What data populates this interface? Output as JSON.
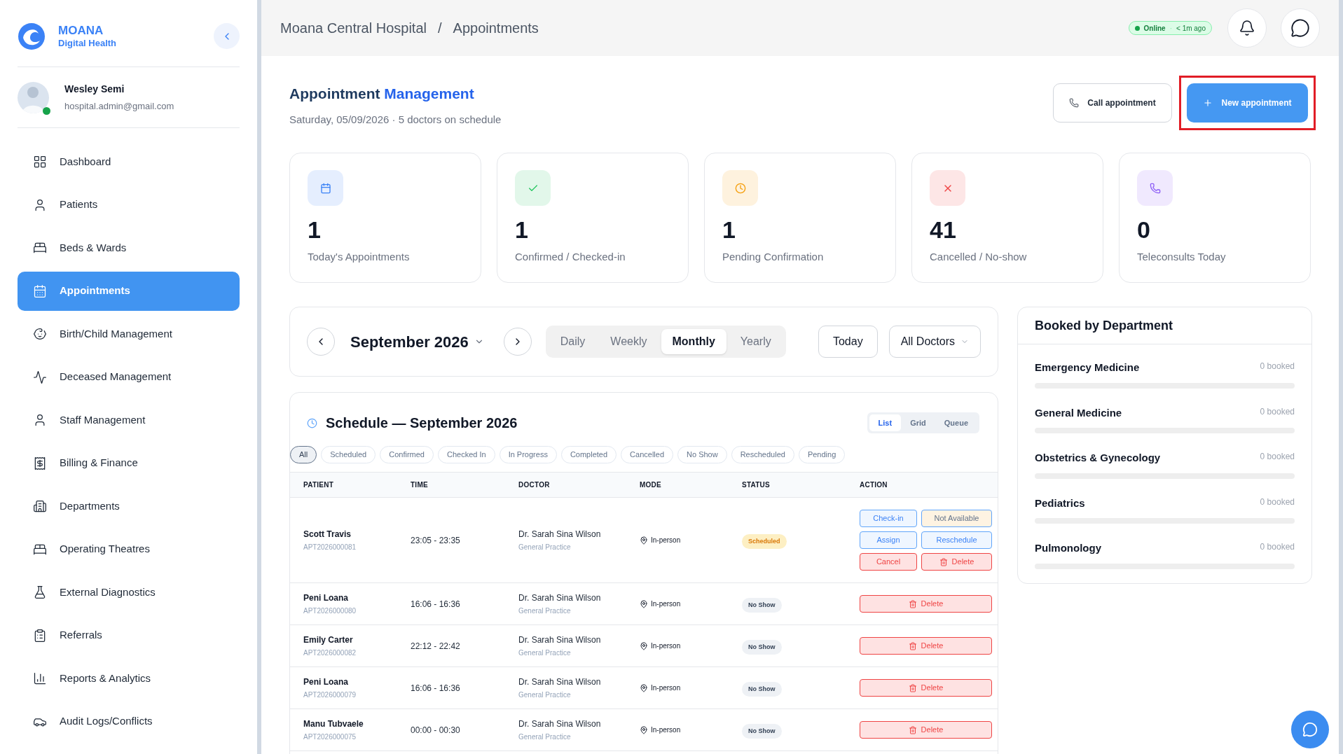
{
  "brand": {
    "name": "MOANA",
    "subtitle": "Digital Health"
  },
  "user": {
    "name": "Wesley Semi",
    "email": "hospital.admin@gmail.com",
    "online": true
  },
  "sidebar": {
    "items": [
      {
        "label": "Dashboard",
        "selected": false
      },
      {
        "label": "Patients",
        "selected": false
      },
      {
        "label": "Beds & Wards",
        "selected": false
      },
      {
        "label": "Appointments",
        "selected": true
      },
      {
        "label": "Birth/Child Management",
        "selected": false
      },
      {
        "label": "Deceased Management",
        "selected": false
      },
      {
        "label": "Staff Management",
        "selected": false
      },
      {
        "label": "Billing & Finance",
        "selected": false
      },
      {
        "label": "Departments",
        "selected": false
      },
      {
        "label": "Operating Theatres",
        "selected": false
      },
      {
        "label": "External Diagnostics",
        "selected": false
      },
      {
        "label": "Referrals",
        "selected": false
      },
      {
        "label": "Reports & Analytics",
        "selected": false
      },
      {
        "label": "Audit Logs/Conflicts",
        "selected": false
      }
    ]
  },
  "breadcrumb": [
    "Moana Central Hospital",
    "/",
    "Appointments"
  ],
  "status": {
    "label": "Online",
    "separator": "·",
    "time": "< 1m ago"
  },
  "page": {
    "title_plain": "Appointment",
    "title_accent": "Management",
    "subtitle": "Saturday, 05/09/2026 · 5 doctors on schedule"
  },
  "buttons": [
    {
      "label": "Call appointment",
      "kind": "secondary"
    },
    {
      "label": "New appointment",
      "kind": "primary"
    }
  ],
  "stats": [
    {
      "value": "1",
      "label": "Today's Appointments",
      "kind": "calendar",
      "color": "#3b82f6"
    },
    {
      "value": "1",
      "label": "Confirmed / Checked-in",
      "kind": "check",
      "color": "#22c55e"
    },
    {
      "value": "1",
      "label": "Pending Confirmation",
      "kind": "clock",
      "color": "#f59e0b"
    },
    {
      "value": "41",
      "label": "Cancelled / No-show",
      "kind": "cross",
      "color": "#ef4444"
    },
    {
      "value": "0",
      "label": "Teleconsults Today",
      "kind": "phone",
      "color": "#8b5cf6"
    }
  ],
  "calendar": {
    "period": "September 2026",
    "views": [
      {
        "label": "Daily",
        "selected": false
      },
      {
        "label": "Weekly",
        "selected": false
      },
      {
        "label": "Monthly",
        "selected": true
      },
      {
        "label": "Yearly",
        "selected": false
      }
    ],
    "today": "Today",
    "doctor_filter": "All Doctors"
  },
  "schedule": {
    "title": "Schedule — September 2026",
    "layouts": [
      {
        "label": "List",
        "selected": true
      },
      {
        "label": "Grid",
        "selected": false
      },
      {
        "label": "Queue",
        "selected": false
      }
    ],
    "filters": [
      {
        "label": "All",
        "selected": true
      },
      {
        "label": "Scheduled",
        "selected": false
      },
      {
        "label": "Confirmed",
        "selected": false
      },
      {
        "label": "Checked In",
        "selected": false
      },
      {
        "label": "In Progress",
        "selected": false
      },
      {
        "label": "Completed",
        "selected": false
      },
      {
        "label": "Cancelled",
        "selected": false
      },
      {
        "label": "No Show",
        "selected": false
      },
      {
        "label": "Rescheduled",
        "selected": false
      },
      {
        "label": "Pending",
        "selected": false
      }
    ],
    "columns": [
      "PATIENT",
      "TIME",
      "DOCTOR",
      "MODE",
      "STATUS",
      "ACTION"
    ],
    "rows": [
      {
        "patient": "Scott Travis",
        "id": "APT2026000081",
        "time": "23:05 - 23:35",
        "doctor": "Dr. Sarah Sina Wilson",
        "specialty": "General Practice",
        "mode": "In-person",
        "status": {
          "label": "Scheduled",
          "kind": "scheduled"
        },
        "actions": [
          {
            "label": "Check-in",
            "kind": "info"
          },
          {
            "label": "Not Available",
            "kind": "warn"
          },
          {
            "label": "Assign",
            "kind": "info"
          },
          {
            "label": "Reschedule",
            "kind": "info"
          },
          {
            "label": "Cancel",
            "kind": "danger"
          },
          {
            "label": "Delete",
            "kind": "delete"
          }
        ]
      },
      {
        "patient": "Peni Loana",
        "id": "APT2026000080",
        "time": "16:06 - 16:36",
        "doctor": "Dr. Sarah Sina Wilson",
        "specialty": "General Practice",
        "mode": "In-person",
        "status": {
          "label": "No Show",
          "kind": "no-show"
        },
        "actions": [
          {
            "label": "Delete",
            "kind": "delete"
          }
        ]
      },
      {
        "patient": "Emily Carter",
        "id": "APT2026000082",
        "time": "22:12 - 22:42",
        "doctor": "Dr. Sarah Sina Wilson",
        "specialty": "General Practice",
        "mode": "In-person",
        "status": {
          "label": "No Show",
          "kind": "no-show"
        },
        "actions": [
          {
            "label": "Delete",
            "kind": "delete"
          }
        ]
      },
      {
        "patient": "Peni Loana",
        "id": "APT2026000079",
        "time": "16:06 - 16:36",
        "doctor": "Dr. Sarah Sina Wilson",
        "specialty": "General Practice",
        "mode": "In-person",
        "status": {
          "label": "No Show",
          "kind": "no-show"
        },
        "actions": [
          {
            "label": "Delete",
            "kind": "delete"
          }
        ]
      },
      {
        "patient": "Manu Tubvaele",
        "id": "APT2026000075",
        "time": "00:00 - 00:30",
        "doctor": "Dr. Sarah Sina Wilson",
        "specialty": "General Practice",
        "mode": "In-person",
        "status": {
          "label": "No Show",
          "kind": "no-show"
        },
        "actions": [
          {
            "label": "Delete",
            "kind": "delete"
          }
        ]
      }
    ]
  },
  "departments": {
    "title": "Booked by Department",
    "items": [
      {
        "name": "Emergency Medicine",
        "reading": "0 booked",
        "level": 0
      },
      {
        "name": "General Medicine",
        "reading": "0 booked",
        "level": 0
      },
      {
        "name": "Obstetrics & Gynecology",
        "reading": "0 booked",
        "level": 0
      },
      {
        "name": "Pediatrics",
        "reading": "0 booked",
        "level": 0
      },
      {
        "name": "Pulmonology",
        "reading": "0 booked",
        "level": 0
      }
    ]
  }
}
